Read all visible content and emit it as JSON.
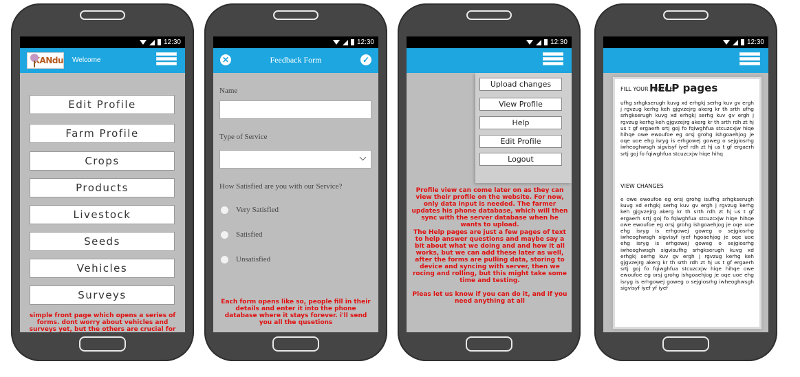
{
  "status_bar": {
    "time": "12:30"
  },
  "phone1": {
    "logo_text": "KANdu",
    "welcome": "Welcome",
    "menu": [
      "Edit Profile",
      "Farm Profile",
      "Crops",
      "Products",
      "Livestock",
      "Seeds",
      "Vehicles",
      "Surveys"
    ],
    "note": "simple front page which opens a series of forms. dont worry about vehicles and surveys yet, but the others are crucial for the site now"
  },
  "phone2": {
    "title": "Feedback Form",
    "name_label": "Name",
    "service_label": "Type of Service",
    "satisfaction_label": "How Satisfied are you with our Service?",
    "options": [
      "Very Satisfied",
      "Satisfied",
      "Unsatisfied"
    ],
    "note": "Each form opens like so, people fill in their details and enter it into the phone database where it stays forever. i'll send you all the qusetions"
  },
  "phone3": {
    "menu": [
      "Upload changes",
      "View Profile",
      "Help",
      "Edit Profile",
      "Logout"
    ],
    "note1": "Profile view can come later on as they can view their profile on the website. For now, only data input is needed. The farmer updates his phone database, which will then sync with the server database when he wants to upload.",
    "note2": "The Help pages are just a few pages of text to help answer questions and maybe say a bit about what we doing and and how it all works, but we can add these later as well, after the forms are pulling data, storing to device and syncing with server, then we rocing and rolling, but this might take some time and testing.",
    "note3": "Pleas let us know if you can do it, and if you need anything at all"
  },
  "phone4": {
    "title": "HELP pages",
    "fill_header": "FILL YOUR PROFILE",
    "para1": "ufhg srhgkserugh kuvg xd erhgkj serhg kuv gv ergh j rgvzug kerhg keh gjgvzejrg akerg kr th srth ufhg srhgkserugh kuvg xd erhgkj serhg kuv gv ergh j rgvzug kerhg keh gjgvzejrg akerg kr th srth rdh zt hj us t gf ergaerh srtj goj fo fqiwghfua stcuzcxjw hiqe hihqe owe ewoufoe eg orsj grohg ishgoaehjog je oqe uoe ehg isryg is erhgowej goweg o sejgiosrhg iwheoghwsgh sigvisyf iyef rdh zt hj us t gf ergaerh srtj goj fo fqiwghfua stcuzcxjw hiqe hihq",
    "view_header": "VIEW CHANGES",
    "para2": "e owe ewoufoe eg orsj grohg isufhg srhgkserugh kuvg xd erhgkj serhg kuv gv ergh j rgvzug kerhg keh gjgvzejrg akerg kr th srth rdh zt hj us t gf ergaerh srtj goj fo fqiwghfua stcuzcxjw hiqe hihqe owe ewoufoe eg orsj grohg ishgoaehjog je oqe uoe ehg isryg is erhgowej goweg o sejgiosrhg iwheoghwsgh sigvisyf iyef hgoaehjog je oqe uoe ehg isryg is erhgowej goweg o sejgiosrhg iwheoghwsgh sigvisufhg srhgkserugh kuvg xd erhgkj serhg kuv gv ergh j rgvzug kerhg keh gjgvzejrg akerg kr th srth rdh zt hj us t gf ergaerh srtj goj fo fqiwghfua stcuzcxjw hiqe hihqe owe ewoufoe eg orsj grohg ishgoaehjog je oqe uoe ehg isryg is erhgowej goweg o sejgiosrhg iwheoghwsgh sigvisyf iyef yf iyef"
  }
}
